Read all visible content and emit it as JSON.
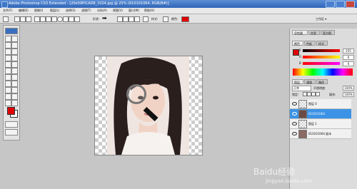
{
  "window": {
    "title": "Adobe Photoshop CS3 Extended - [20e59PICAD8_1024.jpg @ 25% (610101064, RGB/8#)]"
  },
  "menu": [
    "文件(F)",
    "编辑(E)",
    "图像(I)",
    "图层(L)",
    "选择(S)",
    "滤镜(T)",
    "分析(A)",
    "视图(V)",
    "窗口(W)",
    "帮助(H)"
  ],
  "options_bar": {
    "label_shape": "形状:",
    "label_style": "样式:",
    "label_color": "颜色:",
    "color_value": "#e10000",
    "workspace_label": "工作区 ▾"
  },
  "panels": {
    "top_tabs": [
      "导航器",
      "信息",
      "直方图"
    ],
    "color_tabs": [
      "颜色",
      "色板",
      "样式"
    ],
    "rgb": [
      {
        "channel": "R",
        "value": "255"
      },
      {
        "channel": "G",
        "value": "0"
      },
      {
        "channel": "B",
        "value": "0"
      }
    ],
    "layer_tabs": [
      "图层",
      "通道",
      "路径"
    ],
    "blend_mode": "正常",
    "opacity_label": "不透明度:",
    "opacity_value": "100%",
    "lock_label": "锁定:",
    "fill_label": "填充:",
    "fill_value": "100%",
    "layers": [
      {
        "name": "图层 0",
        "selected": false
      },
      {
        "name": "610101064",
        "selected": true
      },
      {
        "name": "图层 1",
        "selected": false
      },
      {
        "name": "610101064 副本",
        "selected": false
      }
    ]
  },
  "watermark": {
    "text": "Baidu经验",
    "sub": "jingyan.baidu.com"
  }
}
